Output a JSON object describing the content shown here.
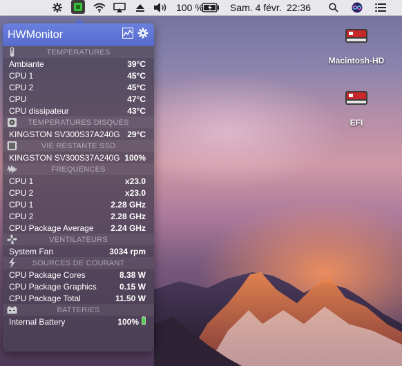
{
  "menubar": {
    "battery_percent": "100 %",
    "datetime": "Sam. 4 févr.",
    "time": "22:36"
  },
  "desktop": {
    "icons": [
      {
        "label": "Macintosh-HD"
      },
      {
        "label": "EFI"
      }
    ]
  },
  "hwmonitor": {
    "title": "HWMonitor",
    "sections": [
      {
        "title": "TEMPERATURES",
        "icon": "thermometer-icon",
        "rows": [
          {
            "k": "Ambiante",
            "v": "39°C"
          },
          {
            "k": "CPU 1",
            "v": "45°C"
          },
          {
            "k": "CPU 2",
            "v": "45°C"
          },
          {
            "k": "CPU",
            "v": "47°C"
          },
          {
            "k": "CPU dissipateur",
            "v": "43°C"
          }
        ]
      },
      {
        "title": "TEMPERATURES DISQUES",
        "icon": "disk-icon",
        "rows": [
          {
            "k": "KINGSTON SV300S37A240G",
            "v": "29°C"
          }
        ]
      },
      {
        "title": "VIE RESTANTE SSD",
        "icon": "ssd-icon",
        "rows": [
          {
            "k": "KINGSTON SV300S37A240G",
            "v": "100%"
          }
        ]
      },
      {
        "title": "FREQUENCES",
        "icon": "frequency-icon",
        "rows": [
          {
            "k": "CPU 1",
            "v": "x23.0"
          },
          {
            "k": "CPU 2",
            "v": "x23.0"
          },
          {
            "k": "CPU 1",
            "v": "2.28 GHz"
          },
          {
            "k": "CPU 2",
            "v": "2.28 GHz"
          },
          {
            "k": "CPU Package Average",
            "v": "2.24 GHz"
          }
        ]
      },
      {
        "title": "VENTILATEURS",
        "icon": "fan-icon",
        "rows": [
          {
            "k": "System Fan",
            "v": "3034 rpm"
          }
        ]
      },
      {
        "title": "SOURCES DE COURANT",
        "icon": "lightning-icon",
        "rows": [
          {
            "k": "CPU Package Cores",
            "v": "8.38 W"
          },
          {
            "k": "CPU Package Graphics",
            "v": "0.15 W"
          },
          {
            "k": "CPU Package Total",
            "v": "11.50 W"
          }
        ]
      },
      {
        "title": "BATTERIES",
        "icon": "battery-icon",
        "rows": [
          {
            "k": "Internal Battery",
            "v": "100%"
          }
        ]
      }
    ]
  }
}
